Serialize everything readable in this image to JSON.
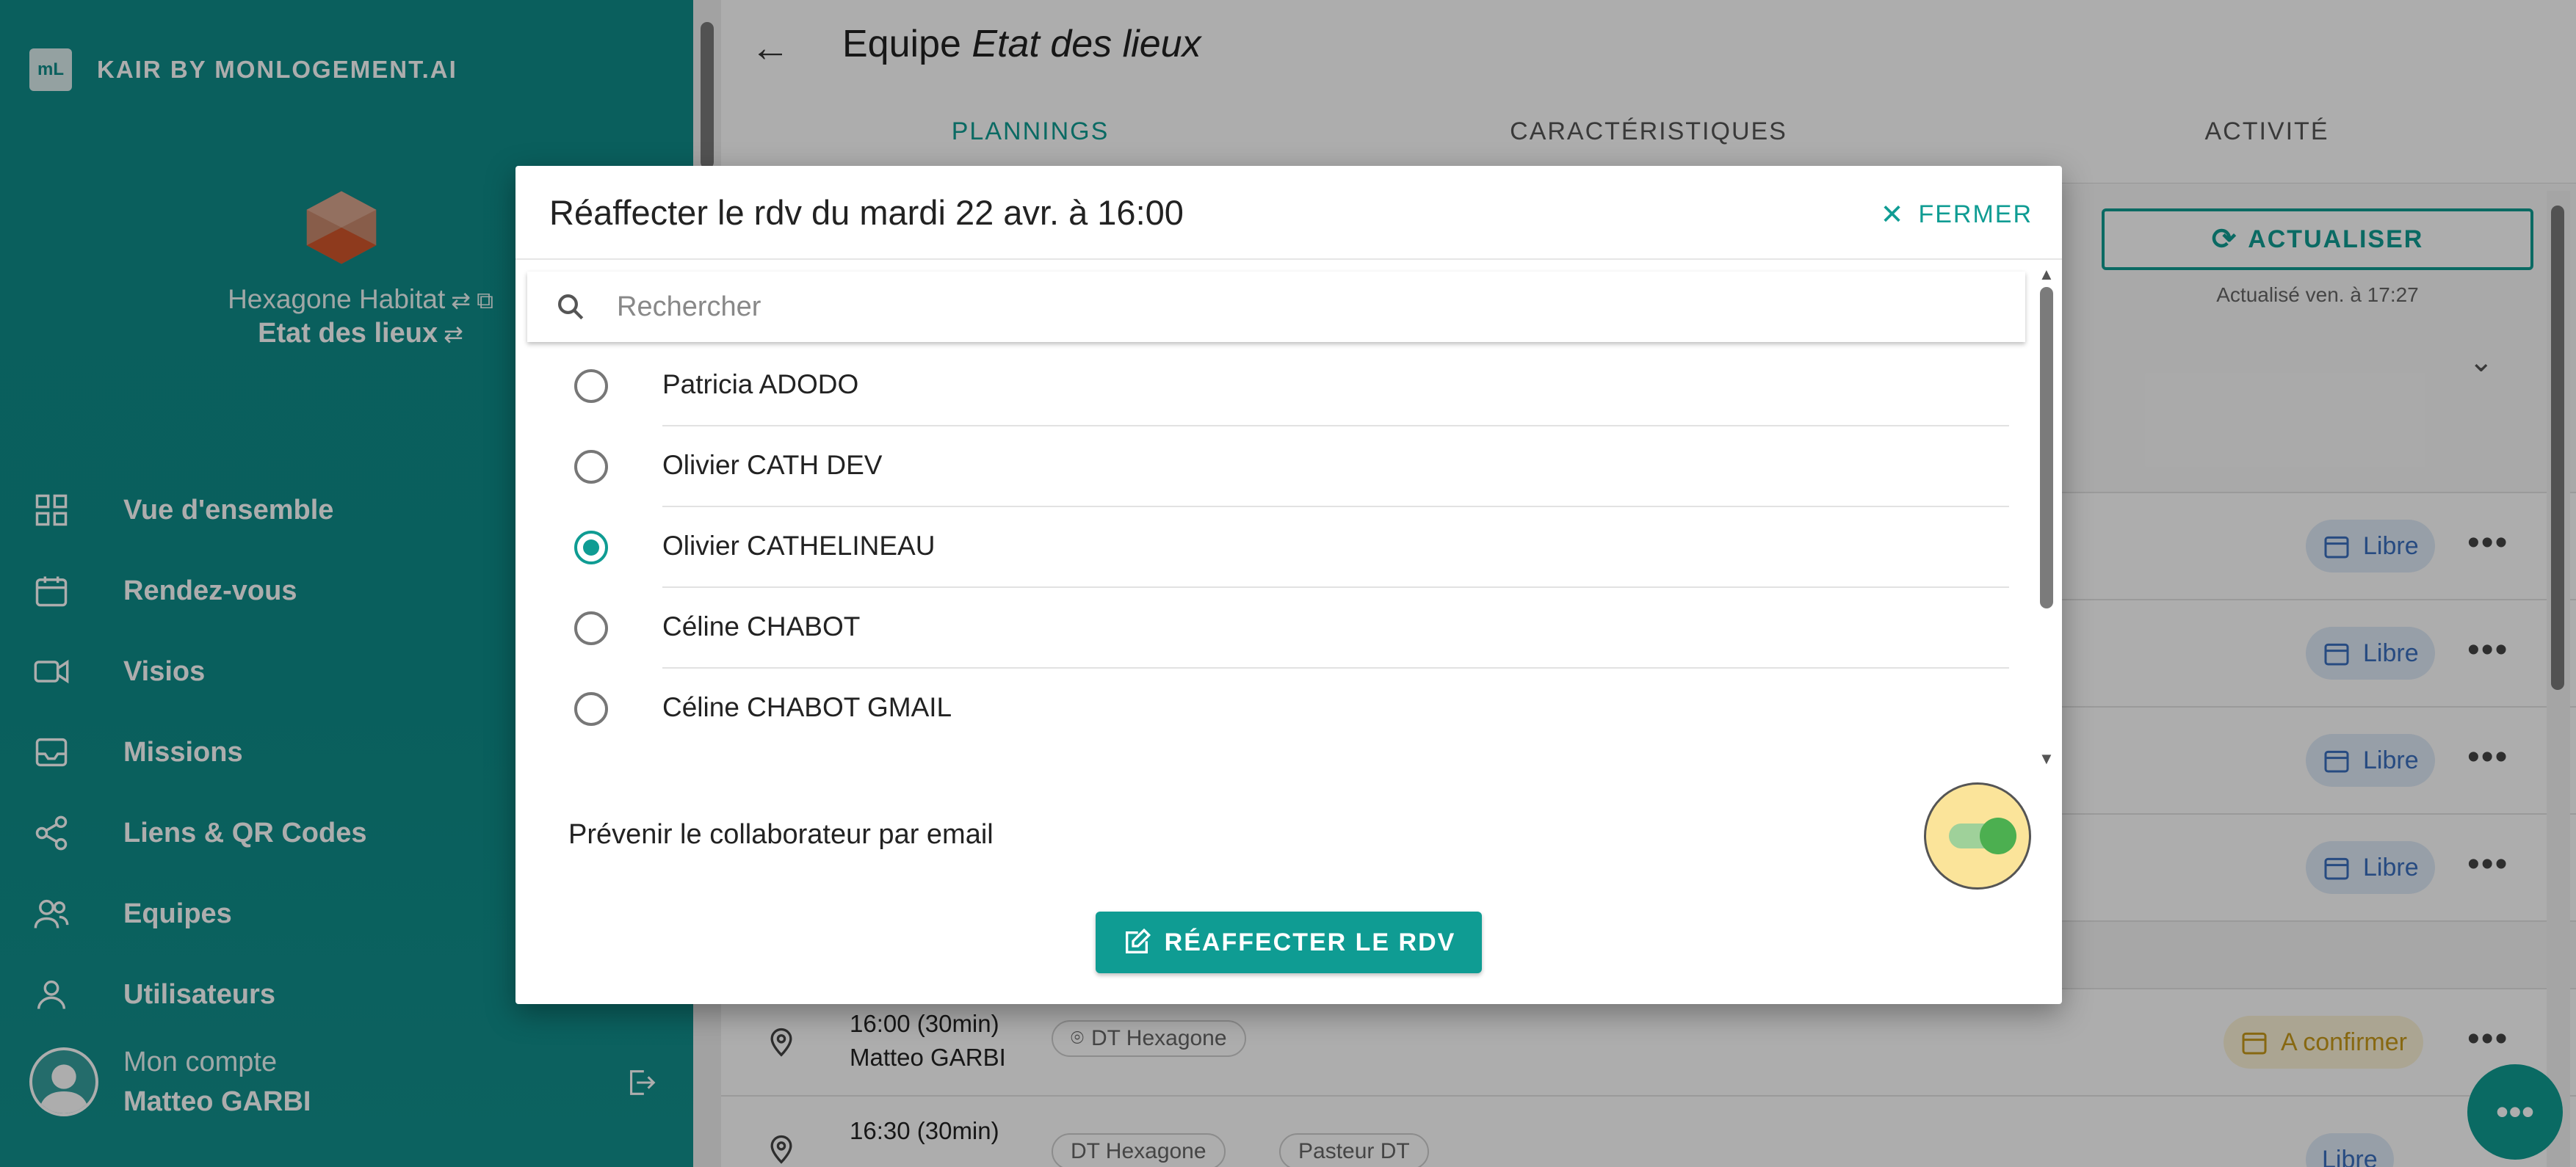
{
  "sidebar": {
    "brand_logo": "mL",
    "brand_name": "KAIR BY MONLOGEMENT.AI",
    "org_name": "Hexagone Habitat",
    "team_name": "Etat des lieux",
    "items": [
      {
        "label": "Vue d'ensemble",
        "icon": "grid-icon"
      },
      {
        "label": "Rendez-vous",
        "icon": "calendar-icon"
      },
      {
        "label": "Visios",
        "icon": "video-icon"
      },
      {
        "label": "Missions",
        "icon": "inbox-icon"
      },
      {
        "label": "Liens & QR Codes",
        "icon": "share-icon"
      },
      {
        "label": "Equipes",
        "icon": "team-icon"
      },
      {
        "label": "Utilisateurs",
        "icon": "user-icon"
      }
    ],
    "account_label": "Mon compte",
    "account_name": "Matteo GARBI"
  },
  "header": {
    "title_prefix": "Equipe",
    "title_team": "Etat des lieux",
    "tabs": [
      "PLANNINGS",
      "CARACTÉRISTIQUES",
      "ACTIVITÉ"
    ],
    "active_tab": "PLANNINGS"
  },
  "main": {
    "refresh_label": "ACTUALISER",
    "refresh_note": "Actualisé ven. à 17:27",
    "slot_badge": "Libre",
    "rows": [
      {
        "time": "16:00 (30min)",
        "name": "Matteo GARBI",
        "location": "DT Hexagone",
        "status": "A confirmer"
      },
      {
        "time": "16:30 (30min)",
        "name": "",
        "location": "DT Hexagone",
        "location2": "Pasteur DT",
        "status": "Libre"
      }
    ]
  },
  "dialog": {
    "title": "Réaffecter le rdv du mardi 22 avr. à 16:00",
    "close_label": "FERMER",
    "search_placeholder": "Rechercher",
    "options": [
      {
        "label": "Patricia ADODO",
        "selected": false
      },
      {
        "label": "Olivier CATH DEV",
        "selected": false
      },
      {
        "label": "Olivier CATHELINEAU",
        "selected": true
      },
      {
        "label": "Céline CHABOT",
        "selected": false
      },
      {
        "label": "Céline CHABOT GMAIL",
        "selected": false
      }
    ],
    "notify_label": "Prévenir le collaborateur par email",
    "notify_enabled": true,
    "submit_label": "RÉAFFECTER LE RDV"
  },
  "colors": {
    "primary": "#0f9c93",
    "sidebar": "#0f8c8a",
    "badge_free": "#3a6fbf",
    "badge_warn": "#c79a1a"
  }
}
